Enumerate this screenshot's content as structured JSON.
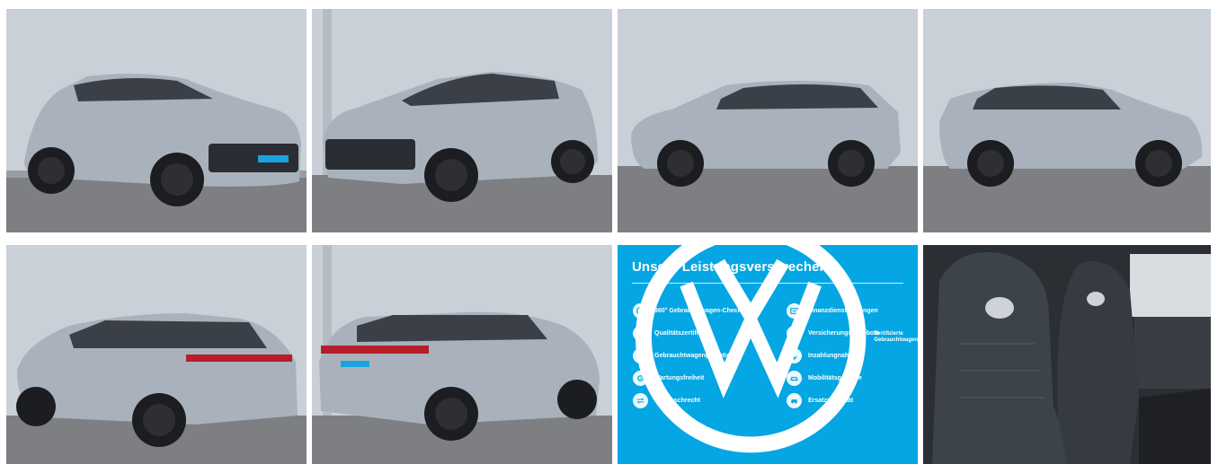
{
  "gallery": {
    "photos": [
      {
        "icon": "car-front-left-photo"
      },
      {
        "icon": "car-front-right-photo"
      },
      {
        "icon": "car-side-left-photo"
      },
      {
        "icon": "car-side-right-photo"
      },
      {
        "icon": "car-rear-left-photo"
      },
      {
        "icon": "car-rear-right-photo"
      },
      {
        "icon": "car-interior-seats-photo"
      }
    ],
    "colors": {
      "wall": "#c9d0d8",
      "ground": "#7d7f82",
      "car_body": "#a9b2bc",
      "promo_bg": "#04a6e3"
    }
  },
  "promo": {
    "title": "Unsere Leistungsversprechen",
    "items": [
      {
        "label": "360° Gebrauchtwagen-Check",
        "icon": "check-360-icon"
      },
      {
        "label": "Finanzdienstleistungen",
        "icon": "finance-icon"
      },
      {
        "label": "Qualitätszertifikat",
        "icon": "certificate-icon"
      },
      {
        "label": "Versicherungsangebote",
        "icon": "insurance-icon"
      },
      {
        "label": "Gebrauchtwagengarantie",
        "icon": "warranty-icon"
      },
      {
        "label": "Inzahlungnahme",
        "icon": "trade-in-icon"
      },
      {
        "label": "Wartungsfreiheit",
        "icon": "maintenance-icon"
      },
      {
        "label": "Mobilitätsgarantie",
        "icon": "mobility-icon"
      },
      {
        "label": "Umtauschrecht",
        "icon": "exchange-icon"
      },
      {
        "label": "Ersatzmobilität",
        "icon": "replacement-car-icon"
      }
    ],
    "footer_line1": "Zertifizierte",
    "footer_line2": "Gebrauchtwagen"
  }
}
